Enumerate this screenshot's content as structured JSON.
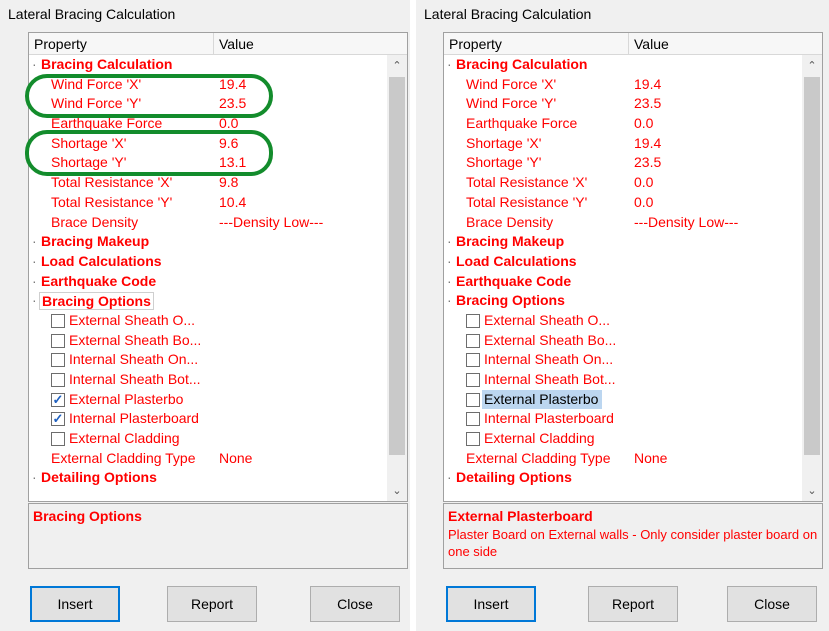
{
  "left": {
    "title": "Lateral Bracing Calculation",
    "header": {
      "property": "Property",
      "value": "Value"
    },
    "rows": [
      {
        "kind": "cat",
        "label": "Bracing Calculation"
      },
      {
        "kind": "prop",
        "label": "Wind Force 'X'",
        "value": "19.4"
      },
      {
        "kind": "prop",
        "label": "Wind Force 'Y'",
        "value": "23.5"
      },
      {
        "kind": "prop",
        "label": "Earthquake Force",
        "value": "0.0"
      },
      {
        "kind": "prop",
        "label": "Shortage 'X'",
        "value": "9.6"
      },
      {
        "kind": "prop",
        "label": "Shortage 'Y'",
        "value": "13.1"
      },
      {
        "kind": "prop",
        "label": "Total Resistance 'X'",
        "value": "9.8"
      },
      {
        "kind": "prop",
        "label": "Total Resistance 'Y'",
        "value": "10.4"
      },
      {
        "kind": "prop",
        "label": "Brace Density",
        "value": "---Density Low---"
      },
      {
        "kind": "cat",
        "label": "Bracing Makeup"
      },
      {
        "kind": "cat",
        "label": "Load Calculations"
      },
      {
        "kind": "cat",
        "label": "Earthquake Code"
      },
      {
        "kind": "cat",
        "label": "Bracing Options",
        "boxed": true
      },
      {
        "kind": "chk",
        "label": "External Sheath O...",
        "checked": false
      },
      {
        "kind": "chk",
        "label": "External Sheath Bo...",
        "checked": false
      },
      {
        "kind": "chk",
        "label": "Internal Sheath On...",
        "checked": false
      },
      {
        "kind": "chk",
        "label": "Internal Sheath Bot...",
        "checked": false
      },
      {
        "kind": "chk",
        "label": "External Plasterbo",
        "checked": true
      },
      {
        "kind": "chk",
        "label": "Internal Plasterboard",
        "checked": true
      },
      {
        "kind": "chk",
        "label": "External Cladding",
        "checked": false
      },
      {
        "kind": "prop",
        "label": "External Cladding Type",
        "value": "None"
      },
      {
        "kind": "cat",
        "label": "Detailing Options"
      }
    ],
    "desc_title": "Bracing Options",
    "desc_text": "",
    "buttons": {
      "insert": "Insert",
      "report": "Report",
      "close": "Close"
    }
  },
  "right": {
    "title": "Lateral Bracing Calculation",
    "header": {
      "property": "Property",
      "value": "Value"
    },
    "rows": [
      {
        "kind": "cat",
        "label": "Bracing Calculation"
      },
      {
        "kind": "prop",
        "label": "Wind Force 'X'",
        "value": "19.4"
      },
      {
        "kind": "prop",
        "label": "Wind Force 'Y'",
        "value": "23.5"
      },
      {
        "kind": "prop",
        "label": "Earthquake Force",
        "value": "0.0"
      },
      {
        "kind": "prop",
        "label": "Shortage 'X'",
        "value": "19.4"
      },
      {
        "kind": "prop",
        "label": "Shortage 'Y'",
        "value": "23.5"
      },
      {
        "kind": "prop",
        "label": "Total Resistance 'X'",
        "value": "0.0"
      },
      {
        "kind": "prop",
        "label": "Total Resistance 'Y'",
        "value": "0.0"
      },
      {
        "kind": "prop",
        "label": "Brace Density",
        "value": "---Density Low---"
      },
      {
        "kind": "cat",
        "label": "Bracing Makeup"
      },
      {
        "kind": "cat",
        "label": "Load Calculations"
      },
      {
        "kind": "cat",
        "label": "Earthquake Code"
      },
      {
        "kind": "cat",
        "label": "Bracing Options"
      },
      {
        "kind": "chk",
        "label": "External Sheath O...",
        "checked": false
      },
      {
        "kind": "chk",
        "label": "External Sheath Bo...",
        "checked": false
      },
      {
        "kind": "chk",
        "label": "Internal Sheath On...",
        "checked": false
      },
      {
        "kind": "chk",
        "label": "Internal Sheath Bot...",
        "checked": false
      },
      {
        "kind": "chk",
        "label": "External Plasterbo",
        "checked": false,
        "selected": true
      },
      {
        "kind": "chk",
        "label": "Internal Plasterboard",
        "checked": false
      },
      {
        "kind": "chk",
        "label": "External Cladding",
        "checked": false
      },
      {
        "kind": "prop",
        "label": "External Cladding Type",
        "value": "None"
      },
      {
        "kind": "cat",
        "label": "Detailing Options"
      }
    ],
    "desc_title": "External Plasterboard",
    "desc_text": "Plaster Board on External walls - Only consider plaster board on one side",
    "buttons": {
      "insert": "Insert",
      "report": "Report",
      "close": "Close"
    }
  },
  "icons": {
    "scroll_up": "chevron-up-icon",
    "scroll_down": "chevron-down-icon",
    "checkbox": "checkbox-icon"
  },
  "colors": {
    "accent_red": "#ff0000",
    "highlight_green": "#138c2c",
    "selection_blue": "#bcd6f0",
    "default_button_border": "#0078d7"
  }
}
